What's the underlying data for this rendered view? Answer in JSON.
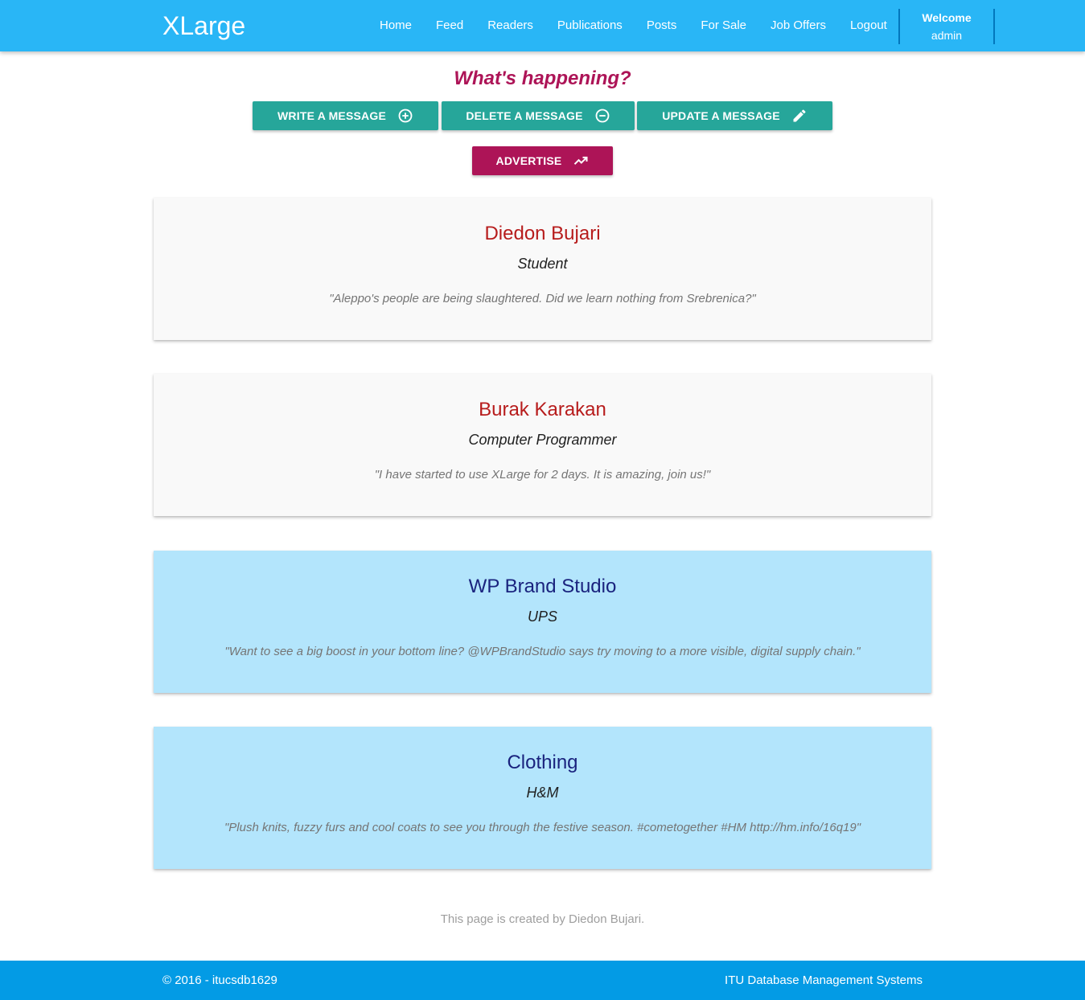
{
  "navbar": {
    "brand": "XLarge",
    "links": [
      "Home",
      "Feed",
      "Readers",
      "Publications",
      "Posts",
      "For Sale",
      "Job Offers",
      "Logout"
    ],
    "welcome_label": "Welcome",
    "welcome_user": "admin"
  },
  "headline": "What's happening?",
  "buttons": {
    "write": "Write a message",
    "delete": "Delete a message",
    "update": "Update a message",
    "advertise": "Advertise"
  },
  "icons": {
    "write": "plus-circle-icon",
    "delete": "minus-circle-icon",
    "update": "pencil-icon",
    "advertise": "trending-up-icon"
  },
  "cards": [
    {
      "name": "Diedon Bujari",
      "role": "Student",
      "message": "\"Aleppo's people are being slaughtered. Did we learn nothing from Srebrenica?\""
    },
    {
      "name": "Burak Karakan",
      "role": "Computer Programmer",
      "message": "\"I have started to use XLarge for 2 days. It is amazing, join us!\""
    },
    {
      "name": "WP Brand Studio",
      "role": "UPS",
      "message": "\"Want to see a big boost in your bottom line? @WPBrandStudio says try moving to a more visible, digital supply chain.\""
    },
    {
      "name": "Clothing",
      "role": "H&M",
      "message": "\"Plush knits, fuzzy furs and cool coats to see you through the festive season. #cometogether #HM http://hm.info/16q19\""
    }
  ],
  "credit": "This page is created by Diedon Bujari.",
  "footer": {
    "left": "© 2016 - itucsdb1629",
    "right": "ITU Database Management Systems"
  },
  "colors": {
    "navbar": "#29b6f6",
    "footer": "#039be5",
    "accent_pink": "#ad1457",
    "teal": "#26a69a",
    "ad_card": "#b3e5fc",
    "post_card": "#f9f9f9"
  }
}
